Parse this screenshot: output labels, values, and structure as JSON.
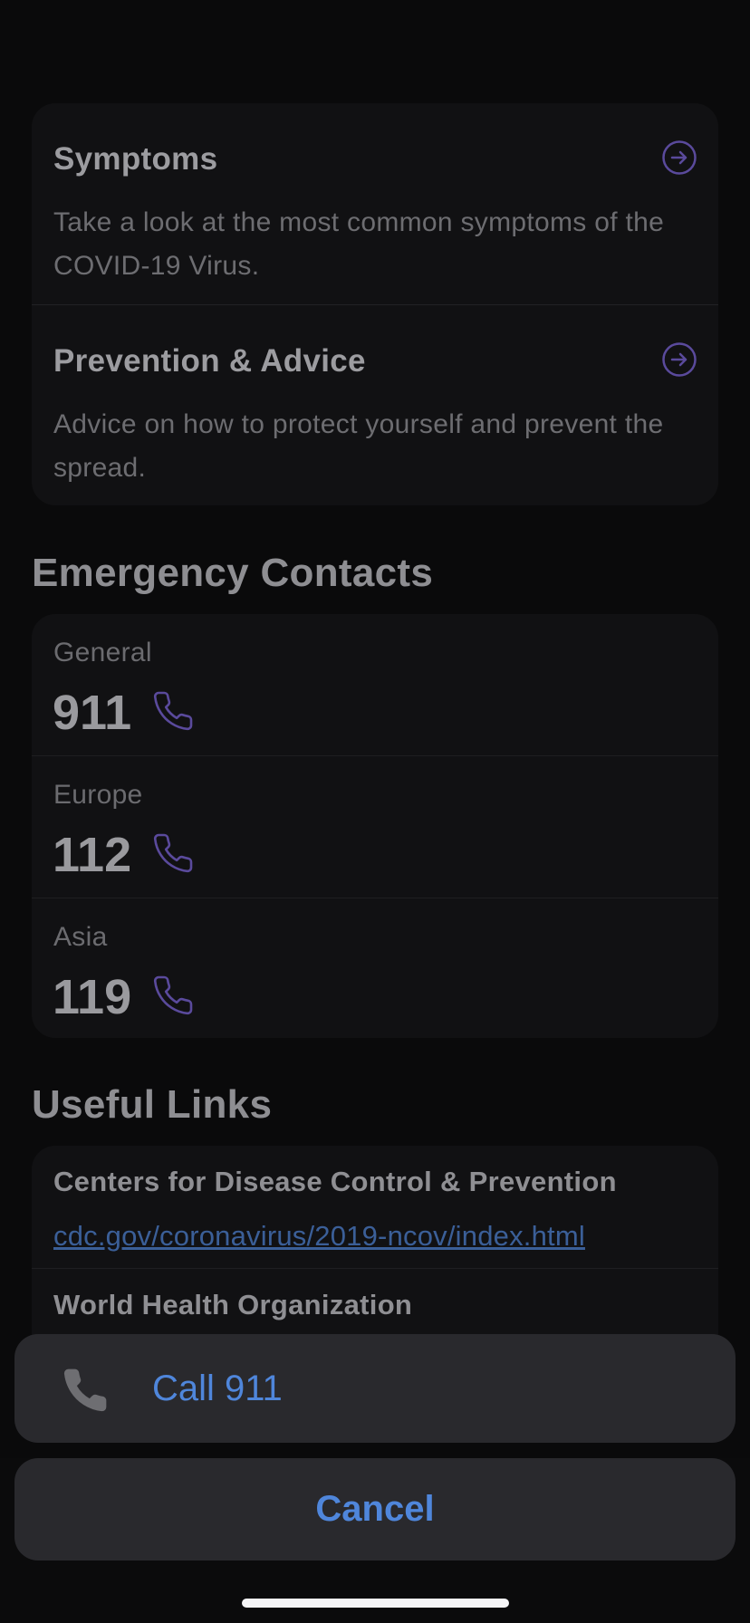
{
  "info_cards": [
    {
      "title": "Symptoms",
      "description": "Take a look at the most common symptoms of the COVID-19 Virus.",
      "icon": "arrow-right-circle-icon"
    },
    {
      "title": "Prevention & Advice",
      "description": "Advice on how to protect yourself and prevent the spread.",
      "icon": "arrow-right-circle-icon"
    }
  ],
  "emergency": {
    "section_title": "Emergency Contacts",
    "contacts": [
      {
        "region": "General",
        "number": "911",
        "icon": "phone-icon"
      },
      {
        "region": "Europe",
        "number": "112",
        "icon": "phone-icon"
      },
      {
        "region": "Asia",
        "number": "119",
        "icon": "phone-icon"
      }
    ]
  },
  "links": {
    "section_title": "Useful Links",
    "items": [
      {
        "name": "Centers for Disease Control & Prevention",
        "url": "cdc.gov/coronavirus/2019-ncov/index.html"
      },
      {
        "name": "World Health Organization"
      }
    ]
  },
  "action_sheet": {
    "call_label": "Call 911",
    "call_icon": "phone-icon",
    "cancel_label": "Cancel"
  },
  "colors": {
    "accent_purple": "#5a4a9c",
    "action_blue": "#4f86db",
    "link_blue": "#3b5f98",
    "background": "#0a0a0b",
    "card": "#111113",
    "sheet": "#29292d"
  }
}
